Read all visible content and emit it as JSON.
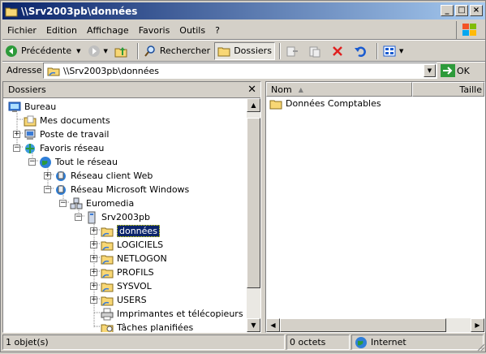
{
  "window": {
    "title": "\\\\Srv2003pb\\données"
  },
  "menu": [
    "Fichier",
    "Edition",
    "Affichage",
    "Favoris",
    "Outils",
    "?"
  ],
  "toolbar": {
    "back": "Précédente",
    "search": "Rechercher",
    "folders": "Dossiers"
  },
  "address": {
    "label": "Adresse",
    "value": "\\\\Srv2003pb\\données",
    "go": "OK"
  },
  "folders_pane": {
    "title": "Dossiers"
  },
  "tree": [
    {
      "label": "Bureau",
      "icon": "desktop-icon"
    },
    {
      "label": "Mes documents",
      "icon": "documents-icon"
    },
    {
      "label": "Poste de travail",
      "icon": "computer-icon"
    },
    {
      "label": "Favoris réseau",
      "icon": "network-places-icon"
    },
    {
      "label": "Tout le réseau",
      "icon": "globe-icon"
    },
    {
      "label": "Réseau client Web",
      "icon": "network-icon"
    },
    {
      "label": "Réseau Microsoft Windows",
      "icon": "network-icon"
    },
    {
      "label": "Euromedia",
      "icon": "domain-icon"
    },
    {
      "label": "Srv2003pb",
      "icon": "server-icon"
    },
    {
      "label": "données",
      "icon": "share-folder-icon"
    },
    {
      "label": "LOGICIELS",
      "icon": "share-folder-icon"
    },
    {
      "label": "NETLOGON",
      "icon": "share-folder-icon"
    },
    {
      "label": "PROFILS",
      "icon": "share-folder-icon"
    },
    {
      "label": "SYSVOL",
      "icon": "share-folder-icon"
    },
    {
      "label": "USERS",
      "icon": "share-folder-icon"
    },
    {
      "label": "Imprimantes et télécopieurs",
      "icon": "printer-icon"
    },
    {
      "label": "Tâches planifiées",
      "icon": "tasks-icon"
    }
  ],
  "list": {
    "columns": [
      "Nom",
      "Taille"
    ],
    "items": [
      {
        "name": "Données Comptables"
      }
    ]
  },
  "status": {
    "count": "1 objet(s)",
    "size": "0 octets",
    "zone": "Internet"
  }
}
